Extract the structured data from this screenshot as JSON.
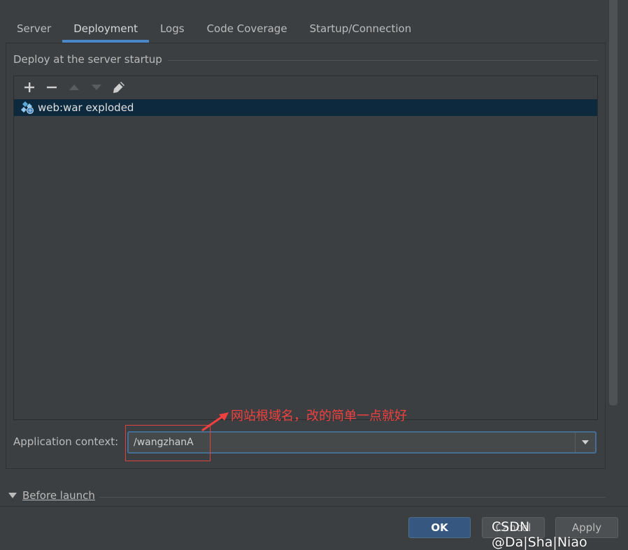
{
  "tabs": [
    {
      "label": "Server"
    },
    {
      "label": "Deployment"
    },
    {
      "label": "Logs"
    },
    {
      "label": "Code Coverage"
    },
    {
      "label": "Startup/Connection"
    }
  ],
  "deploy": {
    "group_title": "Deploy at the server startup",
    "toolbar_icons": [
      "add-icon",
      "remove-icon",
      "move-up-icon",
      "move-down-icon",
      "edit-icon"
    ],
    "items": [
      {
        "label": "web:war exploded",
        "icon": "artifact-exploded-icon",
        "selected": true
      }
    ]
  },
  "context": {
    "label": "Application context:",
    "value": "/wangzhanA"
  },
  "annotation": {
    "text": "网站根域名，改的简单一点就好",
    "color": "#f04040"
  },
  "before_launch": {
    "label": "Before launch"
  },
  "buttons": {
    "ok": "OK",
    "cancel": "Cancel",
    "apply": "Apply"
  },
  "watermark": "CSDN @Da|Sha|Niao",
  "colors": {
    "background": "#3c3f41",
    "accent": "#4a88c7",
    "selection": "#0d293e",
    "ok_button": "#365880"
  }
}
